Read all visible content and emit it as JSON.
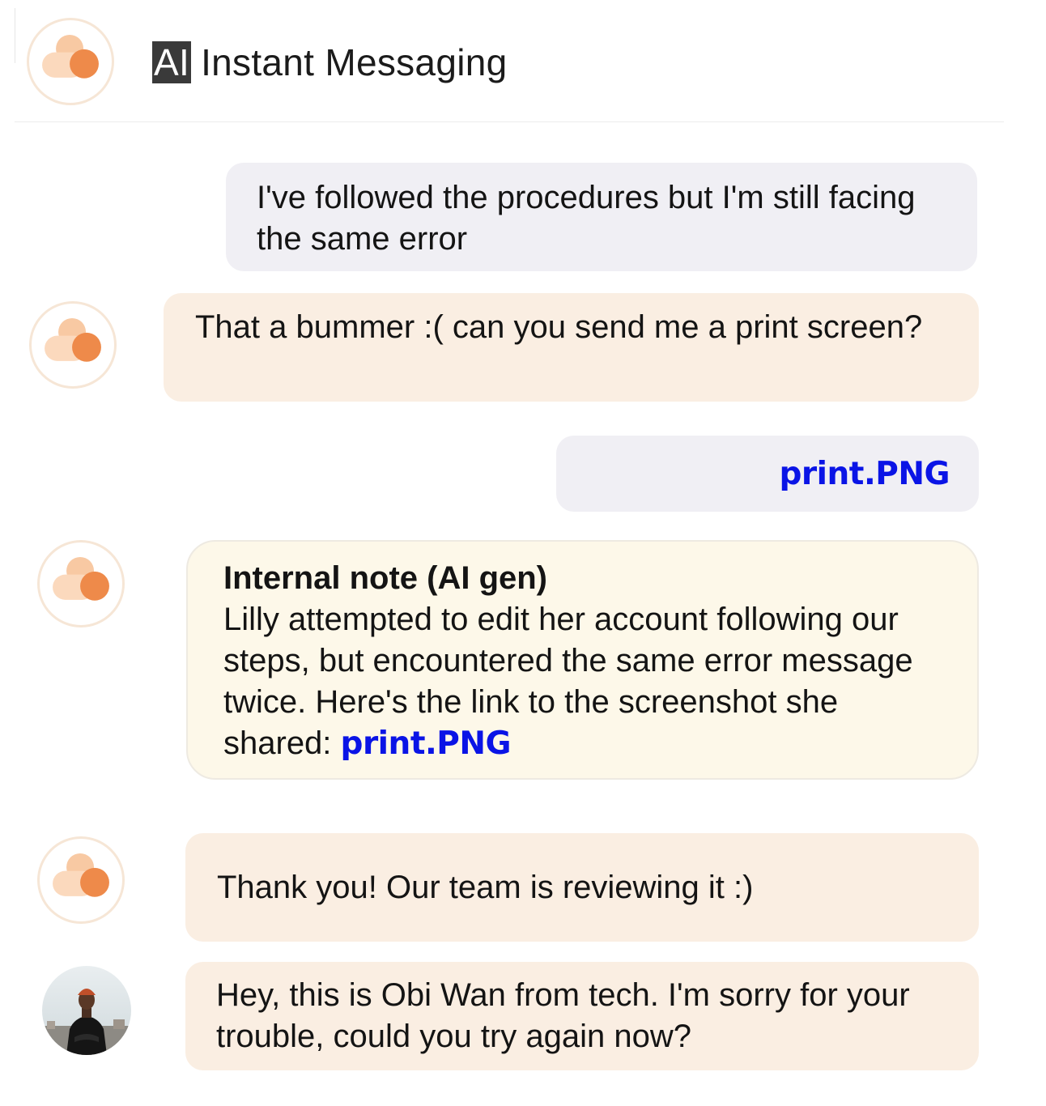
{
  "header": {
    "ai_tag": "AI",
    "title": "Instant Messaging",
    "logo_icon": "cloud-logo-icon"
  },
  "colors": {
    "user_bubble": "#f0eff4",
    "agent_bubble": "#faeee2",
    "note_bubble": "#fdf8e9",
    "link": "#0a14e6",
    "logo_light": "#f8c9a3",
    "logo_dark": "#ee8a4a"
  },
  "messages": [
    {
      "sender": "user",
      "text": "I've followed  the procedures but I'm still facing the same error"
    },
    {
      "sender": "bot",
      "text": "That a bummer :( can you send me a print screen?"
    },
    {
      "sender": "user",
      "attachment": "print.PNG"
    },
    {
      "sender": "bot",
      "type": "internal-note",
      "title": "Internal note (AI gen)",
      "text": "Lilly attempted to edit her account following our steps, but encountered the same error message twice. Here's the link to the screenshot she shared: ",
      "link": "print.PNG"
    },
    {
      "sender": "bot",
      "text": "Thank you! Our team is reviewing it :)"
    },
    {
      "sender": "human-agent",
      "text": "Hey, this is Obi Wan from tech. I'm sorry for your trouble, could you try again now?"
    }
  ]
}
